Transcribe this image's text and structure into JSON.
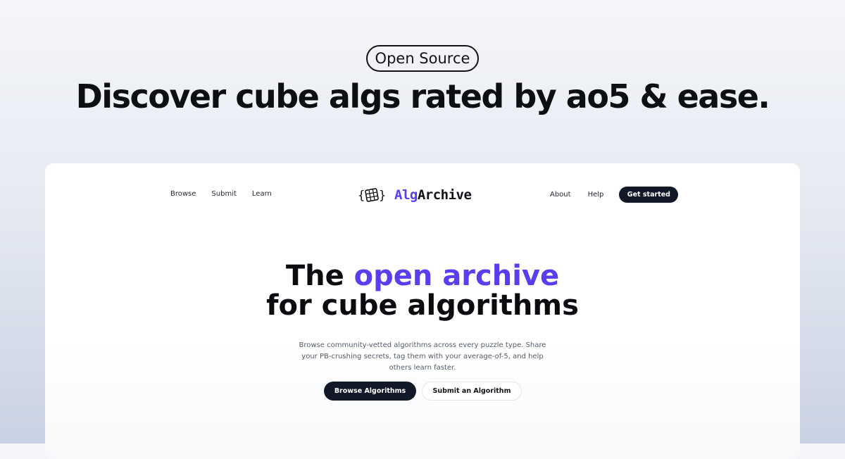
{
  "badge": {
    "label": "Open Source"
  },
  "headline": "Discover cube algs rated by ao5 & ease.",
  "nav": {
    "left_links": [
      "Browse",
      "Submit",
      "Learn"
    ],
    "logo": {
      "icon": "cube-braces-icon",
      "part1": "Alg",
      "part2": "Archive"
    },
    "right_links": [
      "About",
      "Help"
    ],
    "cta": "Get started"
  },
  "hero": {
    "line1_prefix": "The ",
    "line1_accent": "open archive",
    "line2": "for cube algorithms",
    "description": "Browse community-vetted algorithms across every puzzle type. Share your PB-crushing secrets, tag them with your average-of-5, and help others learn faster.",
    "primary_cta": "Browse Algorithms",
    "secondary_cta": "Submit an Algorithm"
  },
  "colors": {
    "accent": "#5b3df0",
    "dark": "#111827",
    "background_top": "#f5f6f9",
    "background_bottom": "#c9d2e3"
  }
}
